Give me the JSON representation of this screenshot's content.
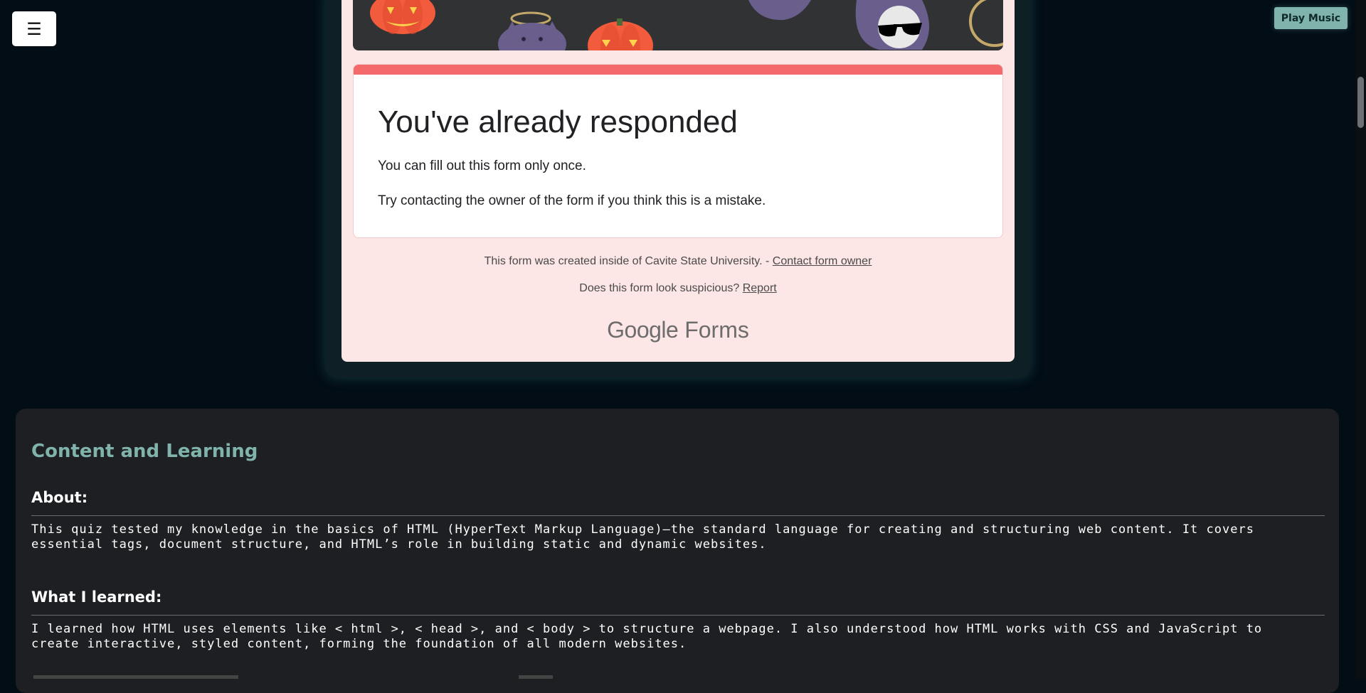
{
  "header": {
    "menu_icon": "☰",
    "play_music_label": "Play Music"
  },
  "form": {
    "title": "You've already responded",
    "line1": "You can fill out this form only once.",
    "line2": "Try contacting the owner of the form if you think this is a mistake.",
    "footer_text": "This form was created inside of Cavite State University. - ",
    "contact_link": "Contact form owner",
    "suspicious_text": "Does this form look suspicious? ",
    "report_link": "Report",
    "brand_google": "Google",
    "brand_forms": "Forms"
  },
  "content": {
    "title": "Content and Learning",
    "about_heading": "About:",
    "about_text": "This quiz tested my knowledge in the basics of HTML (HyperText Markup Language)—the standard language for creating and structuring web content. It covers essential tags, document structure, and HTML’s role in building static and dynamic websites.",
    "learned_heading": "What I learned:",
    "learned_text": "I learned how HTML uses elements like < html >, < head >, and < body > to structure a webpage. I also understood how HTML works with CSS and JavaScript to create interactive, styled content, forming the foundation of all modern websites."
  },
  "colors": {
    "page_bg": "#020d16",
    "accent": "#7fb3ac",
    "form_bg": "#fde6e6",
    "form_stripe": "#f46a6a",
    "section_bg": "#1d1f22"
  },
  "icons": [
    "menu-icon",
    "pumpkin-icon",
    "ghost-icon",
    "cat-angel-icon",
    "sunglasses-ghost-icon"
  ]
}
